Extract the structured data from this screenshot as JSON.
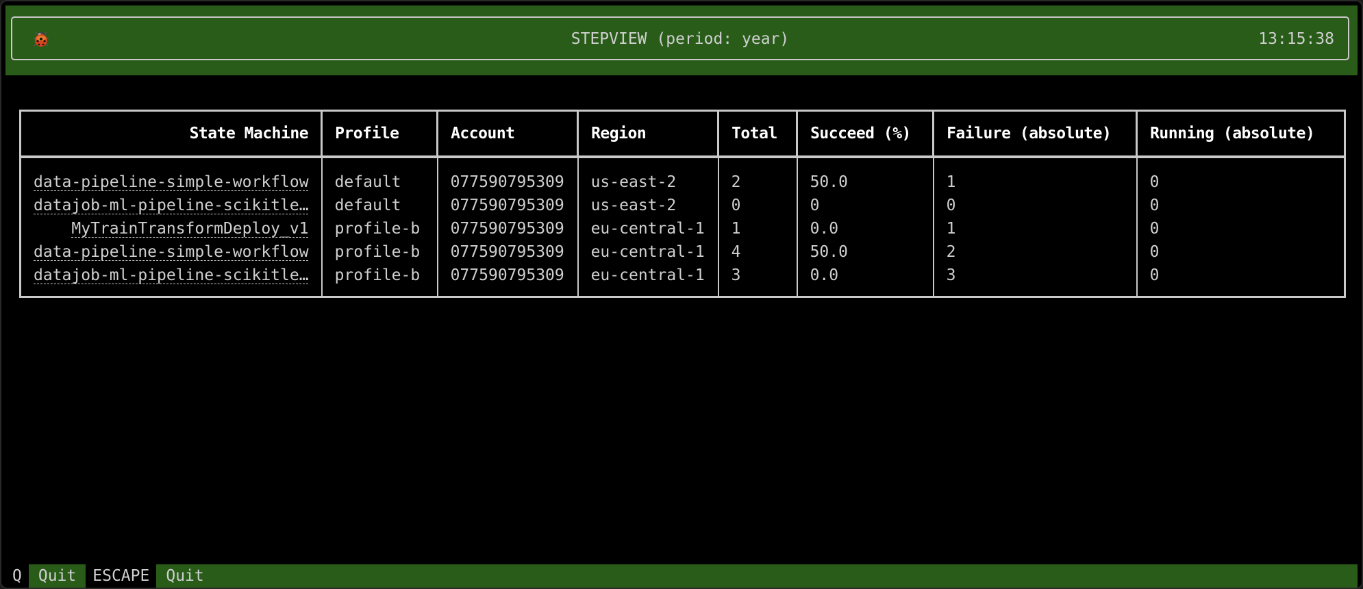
{
  "header": {
    "icon": "ladybug-icon",
    "title": "STEPVIEW (period: year)",
    "clock": "13:15:38"
  },
  "colors": {
    "accent_green": "#295c19",
    "background": "#000000",
    "text": "#cfcfcf",
    "border": "#c9c9c9"
  },
  "table": {
    "columns": [
      "State Machine",
      "Profile",
      "Account",
      "Region",
      "Total",
      "Succeed (%)",
      "Failure (absolute)",
      "Running (absolute)"
    ],
    "rows": [
      [
        "data-pipeline-simple-workflow",
        "default",
        "077590795309",
        "us-east-2",
        "2",
        "50.0",
        "1",
        "0"
      ],
      [
        "datajob-ml-pipeline-scikitle…",
        "default",
        "077590795309",
        "us-east-2",
        "0",
        "0",
        "0",
        "0"
      ],
      [
        "MyTrainTransformDeploy_v1",
        "profile-b",
        "077590795309",
        "eu-central-1",
        "1",
        "0.0",
        "1",
        "0"
      ],
      [
        "data-pipeline-simple-workflow",
        "profile-b",
        "077590795309",
        "eu-central-1",
        "4",
        "50.0",
        "2",
        "0"
      ],
      [
        "datajob-ml-pipeline-scikitle…",
        "profile-b",
        "077590795309",
        "eu-central-1",
        "3",
        "0.0",
        "3",
        "0"
      ]
    ]
  },
  "footer": {
    "bindings": [
      {
        "key": "Q",
        "action": "Quit"
      },
      {
        "key": "ESCAPE",
        "action": "Quit"
      }
    ]
  }
}
